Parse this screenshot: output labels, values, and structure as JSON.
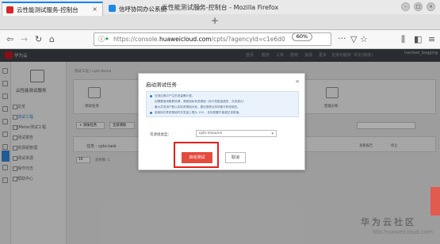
{
  "browser": {
    "window_title": "云性能测试服务-控制台 - Mozilla Firefox",
    "tabs": [
      {
        "label": "云性能测试服务-控制台",
        "active": true,
        "icon": "huawei-cloud-icon"
      },
      {
        "label": "信呼协同办公系统",
        "active": false,
        "icon": "xinhu-icon"
      }
    ],
    "url_prefix": "https://console.",
    "url_domain": "huaweicloud.com",
    "url_suffix": "/cpts/?agencyId=c1e6d0",
    "zoom": "60%"
  },
  "console": {
    "brand": "华为云",
    "header_items": [
      "首页",
      "服务",
      "工单",
      "费用",
      "资源",
      "更多",
      "支持与服务",
      "中文(简体)"
    ],
    "account": "hanlwei_bogging"
  },
  "sidebar": {
    "title": "云性能测试服务",
    "items": [
      "总览",
      "测试工程",
      "JMeter测试工程",
      "测试报告",
      "资源组管理",
      "测试资源",
      "操作日志",
      "帮助中心"
    ]
  },
  "main": {
    "breadcrumb": "测试工程 / cpts-demo",
    "tab_left": "测试任务",
    "tab_right": "智能分析",
    "add_task": "+ 添加任务",
    "batch": "全部清除",
    "task_name": "任务 - cpts-task",
    "right_btns": [
      "查看报告",
      "停止"
    ],
    "pager_size": "10",
    "pager_total": "总条数: 1"
  },
  "modal": {
    "title": "启动测试任务",
    "close": "×",
    "notices": [
      "压测过程中产生的流量需计费。",
      "如需要使用集群资源，请使用私有资源组（执行机数量越多，并发越大）",
      "最大并发用户数以实际资源组为准，建议按照业务场景分阶段施压。",
      "若使用共享资源组时并发量上限为 100 ，实际配置不能超过该数值。"
    ],
    "field_label": "资源组类型：",
    "field_value": "cpts-resource",
    "ok_label": "启动测试",
    "cancel_label": "取消"
  },
  "watermark": {
    "brand": "华为云社区",
    "url": "bbs.huaweicloud.com"
  },
  "colors": {
    "accent": "#e34b3e",
    "highlight": "#e3211b",
    "firefox_tab": "#0a84ff"
  }
}
